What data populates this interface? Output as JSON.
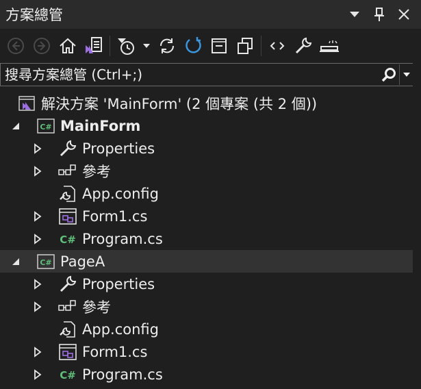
{
  "window": {
    "title": "方案總管"
  },
  "search": {
    "placeholder": "搜尋方案總管 (Ctrl+;)"
  },
  "tree": {
    "solution": {
      "label": "解決方案 'MainForm' (2 個專案 (共 2 個))"
    },
    "projects": [
      {
        "name": "MainForm",
        "items": [
          {
            "label": "Properties"
          },
          {
            "label": "參考"
          },
          {
            "label": "App.config"
          },
          {
            "label": "Form1.cs"
          },
          {
            "label": "Program.cs"
          }
        ]
      },
      {
        "name": "PageA",
        "items": [
          {
            "label": "Properties"
          },
          {
            "label": "參考"
          },
          {
            "label": "App.config"
          },
          {
            "label": "Form1.cs"
          },
          {
            "label": "Program.cs"
          }
        ]
      }
    ]
  },
  "colors": {
    "background": "#1f1f1f",
    "titlebar": "#2b2b2b",
    "selected_row": "#333333",
    "vs_purple": "#9b6fe0",
    "cs_green": "#5fbf7a",
    "refresh_blue": "#3a96dd"
  }
}
